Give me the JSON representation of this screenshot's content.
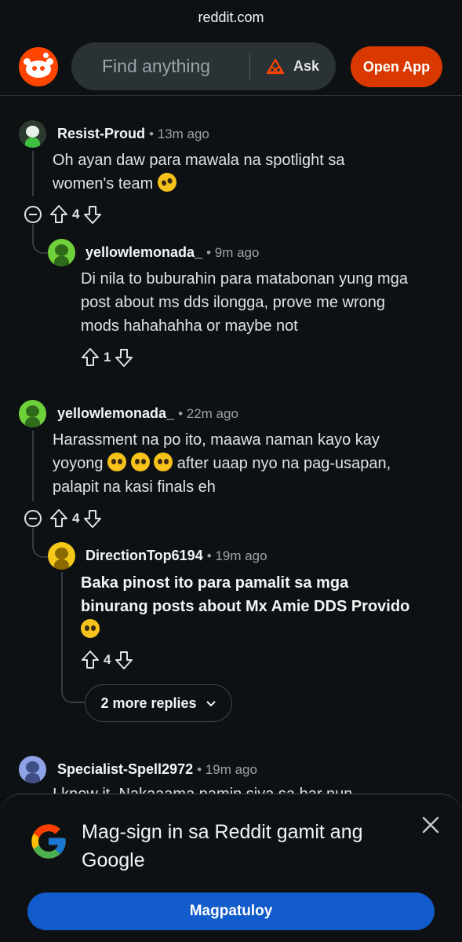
{
  "browser": {
    "url": "reddit.com"
  },
  "header": {
    "logo": "reddit-logo",
    "search_placeholder": "Find anything",
    "ask_label": "Ask",
    "open_app_label": "Open App"
  },
  "comments": [
    {
      "author": "Resist-Proud",
      "time": "13m ago",
      "body_lines": [
        "Oh ayan daw para mawala na spotlight sa",
        "women's team"
      ],
      "votes": "4",
      "avatar_color": "#2b3a2e",
      "replies": [
        {
          "author": "yellowlemonada_",
          "time": "9m ago",
          "body_lines": [
            "Di nila to buburahin para matabonan yung mga",
            "post about ms dds ilongga, prove me wrong",
            "mods hahahahha or maybe not"
          ],
          "votes": "1",
          "avatar_color": "#6fd13a"
        }
      ]
    },
    {
      "author": "yellowlemonada_",
      "time": "22m ago",
      "body_lines": [
        "Harassment na po ito, maawa naman kayo kay",
        "yoyong",
        "after uaap nyo na pag-usapan,",
        "palapit na kasi finals eh"
      ],
      "votes": "4",
      "avatar_color": "#6fd13a",
      "replies": [
        {
          "author": "DirectionTop6194",
          "time": "19m ago",
          "body_lines": [
            "Baka pinost ito para pamalit sa mga",
            "binurang posts about Mx Amie DDS Provido"
          ],
          "votes": "4",
          "avatar_color": "#f4c81a"
        }
      ],
      "more_replies_label": "2 more replies"
    },
    {
      "author": "Specialist-Spell2972",
      "time": "19m ago",
      "partial_body": "I knew it. Nakaaama pamin siya sa bar nun",
      "avatar_color": "#8ea3e6"
    }
  ],
  "signin_sheet": {
    "title": "Mag-sign in sa Reddit gamit ang Google",
    "button_label": "Magpatuloy",
    "icon": "google-icon"
  },
  "colors": {
    "background": "#0e1113",
    "accent_orange": "#d93900",
    "google_blue": "#115bca"
  }
}
